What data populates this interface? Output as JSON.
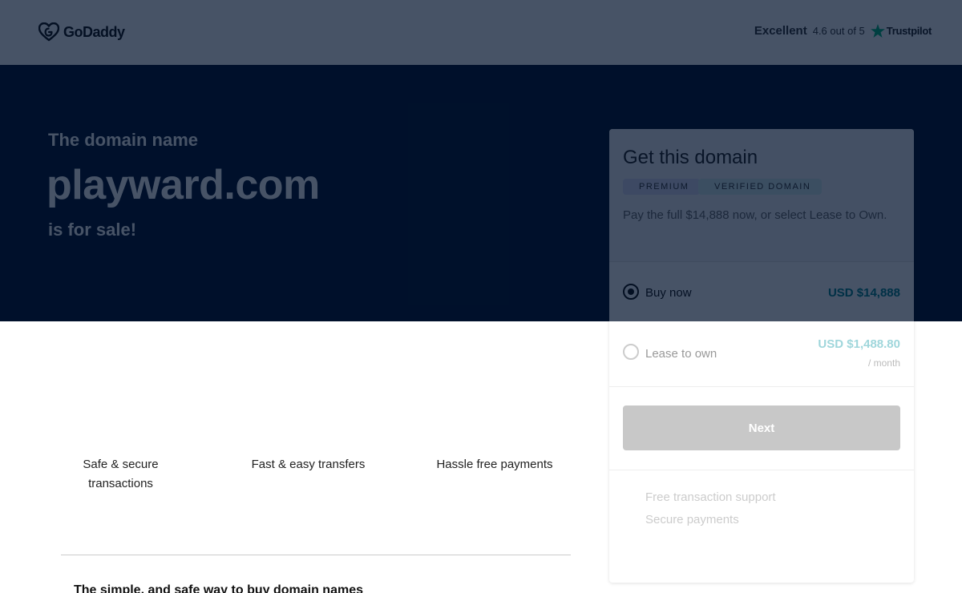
{
  "header": {
    "logo_text": "GoDaddy",
    "trustpilot": {
      "rating_word": "Excellent",
      "score": "4.6 out of 5",
      "brand": "Trustpilot",
      "star_color": "#00b67a"
    }
  },
  "hero": {
    "kicker": "The domain name",
    "domain": "playward.com",
    "tagline": "is for sale!"
  },
  "features": [
    "Safe & secure transactions",
    "Fast & easy transfers",
    "Hassle free payments"
  ],
  "bottom_heading": "The simple, and safe way to buy domain names",
  "panel": {
    "title": "Get this domain",
    "badges": {
      "premium": "PREMIUM",
      "verified": "VERIFIED DOMAIN"
    },
    "description": "Pay the full $14,888 now, or select Lease to Own.",
    "buy": {
      "label": "Buy now",
      "price": "USD $14,888",
      "selected": true
    },
    "lease": {
      "label": "Lease to own",
      "price": "USD $1,488.80",
      "period": "/ month",
      "selected": false
    },
    "next_label": "Next",
    "perks": [
      "Free transaction support",
      "Secure payments"
    ]
  },
  "colors": {
    "hero_bg": "#00112b",
    "price_accent": "#00838c"
  }
}
